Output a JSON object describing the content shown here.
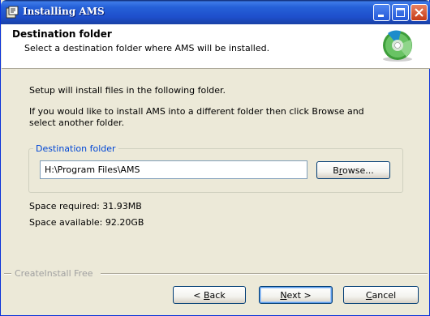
{
  "window": {
    "title": "Installing AMS",
    "app_icon": "installer-icon",
    "minimize_icon": "minimize-icon",
    "maximize_icon": "maximize-icon",
    "close_icon": "close-icon"
  },
  "header": {
    "title": "Destination folder",
    "subtitle": "Select a destination folder where AMS will be installed.",
    "icon": "cd-disc-icon"
  },
  "body": {
    "intro": "Setup will install files in the following folder.",
    "instructions_line1": "If you would like to install AMS into a different folder then click Browse and",
    "instructions_line2": "select another folder."
  },
  "destination": {
    "group_label": "Destination folder",
    "path_value": "H:\\Program Files\\AMS",
    "browse_prefix": "B",
    "browse_mnemonic": "r",
    "browse_suffix": "owse..."
  },
  "space": {
    "required": "Space required: 31.93MB",
    "available": "Space available: 92.20GB"
  },
  "footer": {
    "brand": "CreateInstall Free",
    "back_prefix": "< ",
    "back_mnemonic": "B",
    "back_suffix": "ack",
    "next_mnemonic": "N",
    "next_suffix": "ext >",
    "cancel_mnemonic": "C",
    "cancel_suffix": "ancel"
  },
  "colors": {
    "titlebar": "#2560D8",
    "window_face": "#ECE9D8",
    "group_label": "#0046D5",
    "brand_text": "#A0A0A0"
  }
}
